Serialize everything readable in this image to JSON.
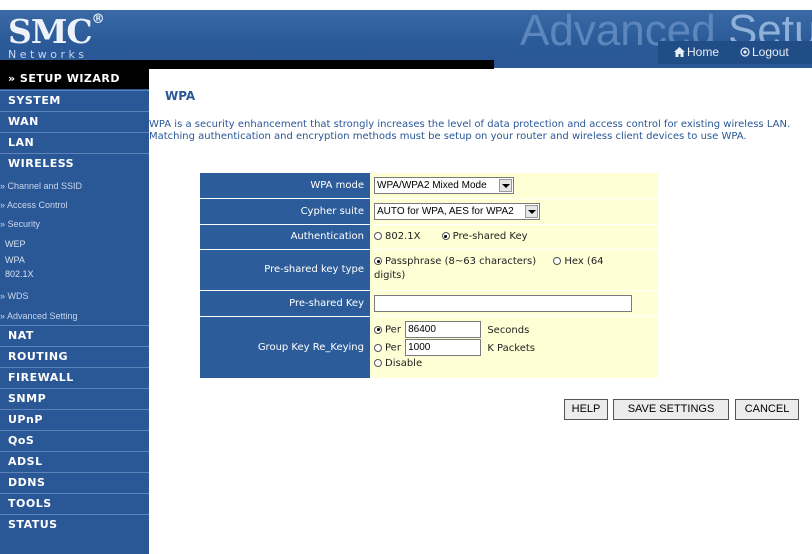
{
  "header": {
    "brand": "SMC",
    "brand_mark": "®",
    "brand_sub": "Networks",
    "title_a": "Advanced",
    "title_b": "Setup",
    "home_label": "Home",
    "logout_label": "Logout"
  },
  "sidebar": {
    "setup_wizard": "» SETUP WIZARD",
    "system": "SYSTEM",
    "wan": "WAN",
    "lan": "LAN",
    "wireless": "WIRELESS",
    "channel_ssid": "» Channel and SSID",
    "access_control": "» Access Control",
    "security": "» Security",
    "wep": "WEP",
    "wpa": "WPA",
    "dot1x": "802.1X",
    "wds": "» WDS",
    "advanced_setting": "» Advanced Setting",
    "nat": "NAT",
    "routing": "ROUTING",
    "firewall": "FIREWALL",
    "snmp": "SNMP",
    "upnp": "UPnP",
    "qos": "QoS",
    "adsl": "ADSL",
    "ddns": "DDNS",
    "tools": "TOOLS",
    "status": "STATUS"
  },
  "main": {
    "title": "WPA",
    "description": "WPA is a security enhancement that strongly increases the level of data protection and access control for existing wireless LAN. Matching authentication and encryption methods must be setup on your router and wireless client devices to use WPA."
  },
  "form": {
    "wpa_mode_label": "WPA mode",
    "wpa_mode_value": "WPA/WPA2 Mixed Mode",
    "cypher_label": "Cypher suite",
    "cypher_value": "AUTO for WPA, AES for WPA2",
    "auth_label": "Authentication",
    "auth_opt1": "802.1X",
    "auth_opt2": "Pre-shared Key",
    "psk_type_label": "Pre-shared key type",
    "psk_type_opt1": "Passphrase (8~63 characters)",
    "psk_type_opt2a": "Hex (64",
    "psk_type_opt2b": "digits)",
    "psk_label": "Pre-shared Key",
    "psk_value": "",
    "gk_label": "Group Key Re_Keying",
    "gk_per_label": "Per",
    "gk_seconds_value": "86400",
    "gk_seconds_unit": "Seconds",
    "gk_packets_value": "1000",
    "gk_packets_unit": "K Packets",
    "gk_disable": "Disable"
  },
  "buttons": {
    "help": "HELP",
    "save": "SAVE SETTINGS",
    "cancel": "CANCEL"
  },
  "colors": {
    "sidebar_bg": "#2a5796",
    "label_bg": "#2d5c9a",
    "value_bg": "#ffffd6",
    "text_blue": "#2a5796"
  }
}
